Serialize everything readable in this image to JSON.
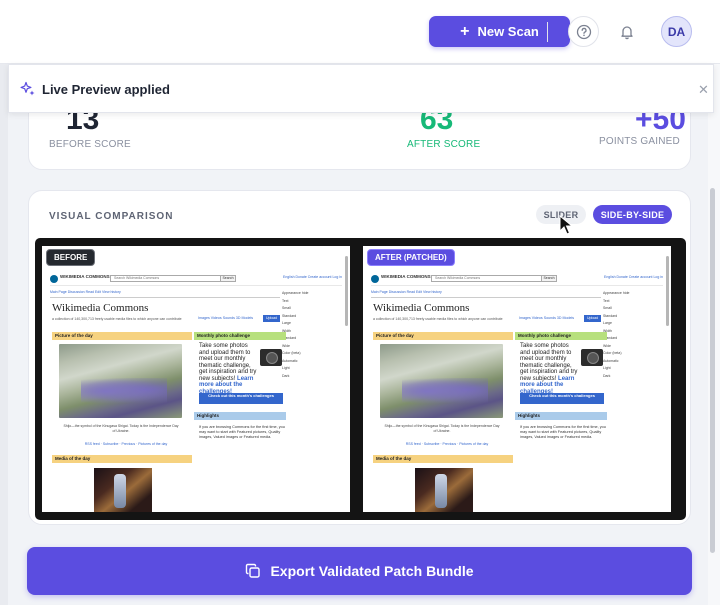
{
  "header": {
    "new_scan_label": "New Scan",
    "avatar_initials": "DA"
  },
  "toast": {
    "title": "Live Preview applied"
  },
  "scores": {
    "before_value": "13",
    "before_label": "BEFORE SCORE",
    "after_value": "63",
    "after_label": "AFTER SCORE",
    "gained_value": "+50",
    "gained_label": "POINTS GAINED"
  },
  "comparison": {
    "title": "VISUAL COMPARISON",
    "tab_slider": "SLIDER",
    "tab_side_by_side": "SIDE-BY-SIDE",
    "active_tab": "SIDE-BY-SIDE",
    "before_badge": "BEFORE",
    "after_badge": "AFTER (PATCHED)"
  },
  "preview": {
    "logo_text": "WIKIMEDIA COMMONS",
    "search_placeholder": "Search Wikimedia Commons",
    "search_button": "Search",
    "header_links": "English  Donate  Create account  Log in",
    "tabs": "Main Page   Discussion                                                                Read   Edit   View history",
    "appearance": [
      "Appearance  hide",
      "Text",
      "Small",
      "Standard",
      "Large",
      "Width",
      "Standard",
      "Wide",
      "Color (beta)",
      "Automatic",
      "Light",
      "Dark"
    ],
    "heading": "Wikimedia Commons",
    "subtitle": "a collection of 140,300,713 freely usable media files to which anyone can contribute",
    "nav": "Images   Videos   Sounds   3D Models",
    "upload": "Upload",
    "potd_title": "Picture of the day",
    "potd_caption": "Shijo—the symbol of the Kinugasa Shigai. Today is the Independence Day of Ukraine.",
    "mpc_title": "Monthly photo challenge",
    "mpc_text": "Take some photos and upload them to meet our monthly thematic challenge, get inspiration and try new subjects!",
    "mpc_link": "Learn more about the challenges!",
    "mpc_button": "Check out this month's challenges",
    "hl_title": "Highlights",
    "hl_text": "If you are browsing Commons for the first time, you may want to start with Featured pictures, Quality images, Valued images or Featured media.",
    "links": "RSS feed · Subscribe · Previous · Pictures of the day",
    "motd_title": "Media of the day"
  },
  "export": {
    "label": "Export Validated Patch Bundle"
  },
  "colors": {
    "accent": "#5b4de0",
    "after_green": "#17b978"
  }
}
